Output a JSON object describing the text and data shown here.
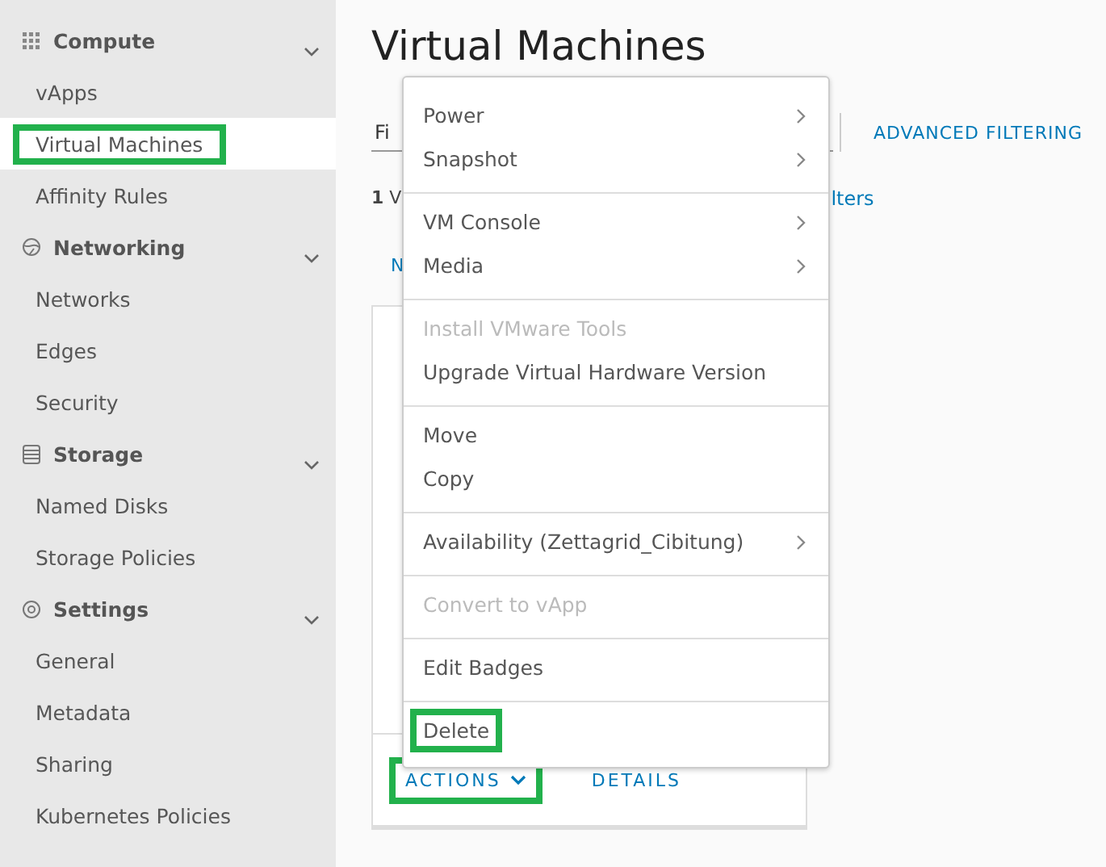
{
  "sidebar": {
    "sections": [
      {
        "label": "Compute",
        "expanded": true,
        "items": [
          {
            "label": "vApps",
            "selected": false,
            "highlighted": false
          },
          {
            "label": "Virtual Machines",
            "selected": true,
            "highlighted": true
          },
          {
            "label": "Affinity Rules",
            "selected": false,
            "highlighted": false
          }
        ]
      },
      {
        "label": "Networking",
        "expanded": true,
        "items": [
          {
            "label": "Networks",
            "selected": false,
            "highlighted": false
          },
          {
            "label": "Edges",
            "selected": false,
            "highlighted": false
          },
          {
            "label": "Security",
            "selected": false,
            "highlighted": false
          }
        ]
      },
      {
        "label": "Storage",
        "expanded": true,
        "items": [
          {
            "label": "Named Disks",
            "selected": false,
            "highlighted": false
          },
          {
            "label": "Storage Policies",
            "selected": false,
            "highlighted": false
          }
        ]
      },
      {
        "label": "Settings",
        "expanded": true,
        "items": [
          {
            "label": "General",
            "selected": false,
            "highlighted": false
          },
          {
            "label": "Metadata",
            "selected": false,
            "highlighted": false
          },
          {
            "label": "Sharing",
            "selected": false,
            "highlighted": false
          },
          {
            "label": "Kubernetes Policies",
            "selected": false,
            "highlighted": false
          }
        ]
      }
    ]
  },
  "page": {
    "title": "Virtual Machines",
    "filter": {
      "value": "Fi"
    },
    "advanced_filtering": "ADVANCED FILTERING",
    "count_text": "**1** V",
    "filters_link": "lters",
    "column_1": "N",
    "card": {
      "actions": {
        "label": "ACTIONS",
        "highlighted": true
      },
      "details": "DETAILS"
    }
  },
  "context_menu": {
    "groups": [
      [
        {
          "label": "Power",
          "submenu": true,
          "disabled": false,
          "highlighted": false
        },
        {
          "label": "Snapshot",
          "submenu": true,
          "disabled": false,
          "highlighted": false
        }
      ],
      [
        {
          "label": "VM Console",
          "submenu": true,
          "disabled": false,
          "highlighted": false
        },
        {
          "label": "Media",
          "submenu": true,
          "disabled": false,
          "highlighted": false
        }
      ],
      [
        {
          "label": "Install VMware Tools",
          "submenu": false,
          "disabled": true,
          "highlighted": false
        },
        {
          "label": "Upgrade Virtual Hardware Version",
          "submenu": false,
          "disabled": false,
          "highlighted": false
        }
      ],
      [
        {
          "label": "Move",
          "submenu": false,
          "disabled": false,
          "highlighted": false
        },
        {
          "label": "Copy",
          "submenu": false,
          "disabled": false,
          "highlighted": false
        }
      ],
      [
        {
          "label": "Availability (Zettagrid_Cibitung)",
          "submenu": true,
          "disabled": false,
          "highlighted": false
        }
      ],
      [
        {
          "label": "Convert to vApp",
          "submenu": false,
          "disabled": true,
          "highlighted": false
        }
      ],
      [
        {
          "label": "Edit Badges",
          "submenu": false,
          "disabled": false,
          "highlighted": false
        }
      ],
      [
        {
          "label": "Delete",
          "submenu": false,
          "disabled": false,
          "highlighted": true
        }
      ]
    ]
  }
}
